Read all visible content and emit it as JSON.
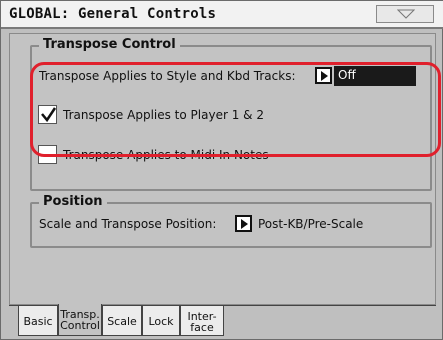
{
  "window": {
    "title": "GLOBAL: General Controls",
    "menu_icon": "triangle-down-icon"
  },
  "transpose_section": {
    "legend": "Transpose Control",
    "style_kbd_label": "Transpose Applies to Style and Kbd Tracks:",
    "style_kbd_value": "Off",
    "player_label": "Transpose Applies to Player 1 & 2",
    "player_checked": true,
    "midi_label": "Transpose Applies to Midi In Notes",
    "midi_checked": false
  },
  "position_section": {
    "legend": "Position",
    "label": "Scale and Transpose Position:",
    "value": "Post-KB/Pre-Scale"
  },
  "tabs": [
    {
      "line1": "Basic",
      "line2": "",
      "active": false
    },
    {
      "line1": "Transp.",
      "line2": "Control",
      "active": true
    },
    {
      "line1": "Scale",
      "line2": "",
      "active": false
    },
    {
      "line1": "Lock",
      "line2": "",
      "active": false
    },
    {
      "line1": "Inter-",
      "line2": "face",
      "active": false
    }
  ],
  "colors": {
    "highlight": "#e0202c",
    "panel": "#c3c3c3",
    "value_box": "#1a1a1a"
  }
}
